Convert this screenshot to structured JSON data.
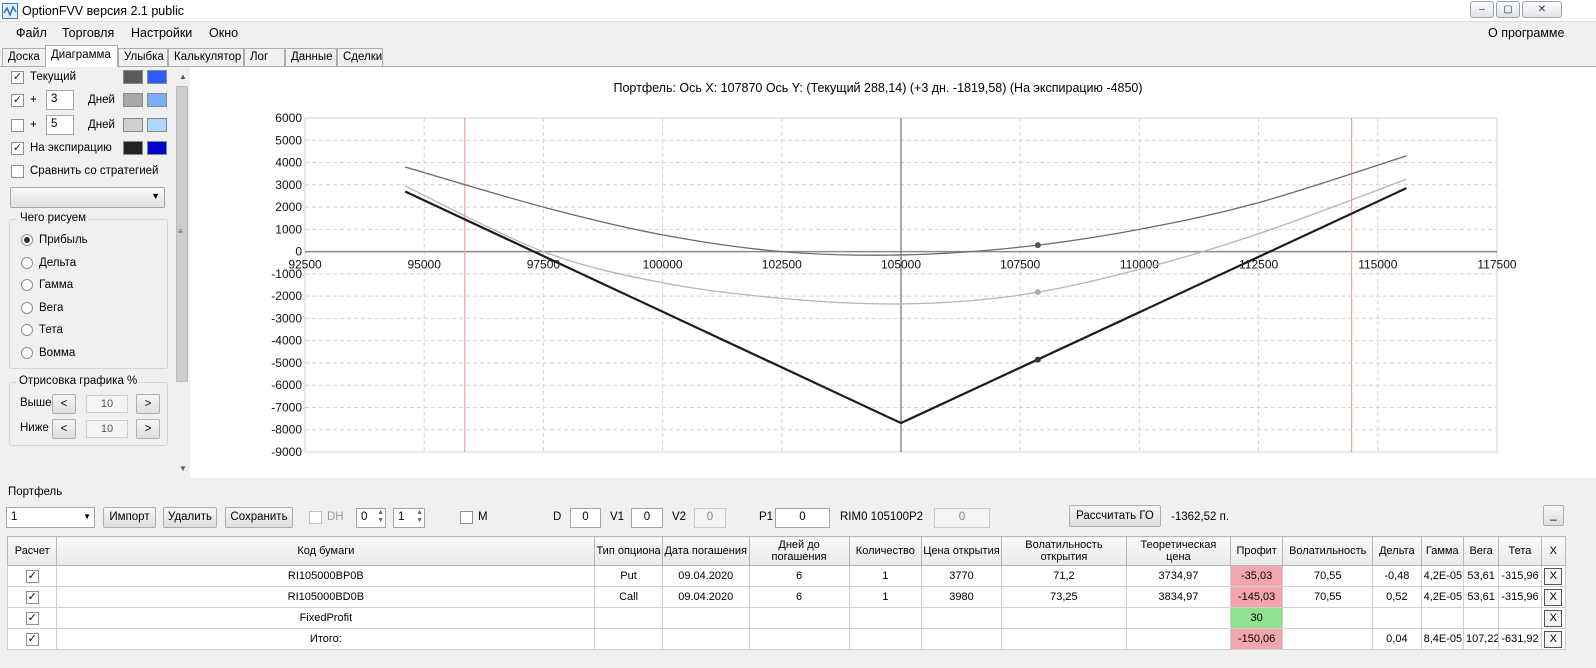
{
  "window": {
    "title": "OptionFVV версия 2.1 public",
    "min": "–",
    "restore": "▢",
    "close": "✕"
  },
  "menu": {
    "items": [
      "Файл",
      "Торговля",
      "Настройки",
      "Окно"
    ],
    "about": "О программе"
  },
  "tabs": [
    "Доска",
    "Диаграмма",
    "Улыбка",
    "Калькулятор",
    "Лог",
    "Данные",
    "Сделки"
  ],
  "left": {
    "current_label": "Текущий",
    "plus": "+",
    "days1": "3",
    "days2": "5",
    "days_label": "Дней",
    "expiry_label": "На экспирацию",
    "compare_label": "Сравнить со стратегией",
    "draw_group": "Чего рисуем",
    "radios": [
      "Прибыль",
      "Дельта",
      "Гамма",
      "Вега",
      "Тета",
      "Вомма"
    ],
    "percent_group": "Отрисовка графика %",
    "above_label": "Выше",
    "below_label": "Ниже",
    "above_value": "10",
    "below_value": "10",
    "left_arrow": "<",
    "right_arrow": ">",
    "colors": {
      "current": [
        "#5a5a5a",
        "#2a5cff"
      ],
      "days1": [
        "#a8a8a8",
        "#7aaeff"
      ],
      "days2": [
        "#cfcfcf",
        "#aed8ff"
      ],
      "expiry": [
        "#222222",
        "#0000cc"
      ]
    }
  },
  "chart_data": {
    "type": "line",
    "title": "Портфель: Ось X: 107870 Ось Y:  (Текущий 288,14)  (+3 дн. -1819,58)  (На экспирацию -4850)",
    "xlim": [
      92500,
      117500
    ],
    "ylim": [
      -9000,
      6000
    ],
    "xticks": [
      92500,
      95000,
      97500,
      100000,
      102500,
      105000,
      107500,
      110000,
      112500,
      115000,
      117500
    ],
    "yticks": [
      6000,
      5000,
      4000,
      3000,
      2000,
      1000,
      0,
      -1000,
      -2000,
      -3000,
      -4000,
      -5000,
      -6000,
      -7000,
      -8000,
      -9000
    ],
    "grid": true,
    "vertical_lines": [
      {
        "x": 105000,
        "color": "#707070"
      },
      {
        "x": 95850,
        "color": "#f2a3a3"
      },
      {
        "x": 114450,
        "color": "#f2a3a3"
      }
    ],
    "cursor_x": 107870,
    "series": [
      {
        "name": "Текущий",
        "color": "#6a6a6a",
        "width": 1.3,
        "x": [
          94600,
          97500,
          100000,
          102500,
          105000,
          107500,
          110000,
          112500,
          115600
        ],
        "y": [
          3800,
          2000,
          750,
          0,
          -150,
          200,
          1000,
          2200,
          4300
        ]
      },
      {
        "name": "+3 дн.",
        "color": "#b5b5b5",
        "width": 1.3,
        "x": [
          94600,
          97500,
          100000,
          102500,
          105000,
          107500,
          110000,
          112500,
          115600
        ],
        "y": [
          2950,
          0,
          -1400,
          -2100,
          -2350,
          -1950,
          -800,
          800,
          3250
        ]
      },
      {
        "name": "На экспирацию",
        "color": "#1c1c1c",
        "width": 2.2,
        "x": [
          94600,
          105000,
          115600
        ],
        "y": [
          2700,
          -7700,
          2850
        ]
      }
    ],
    "markers": [
      {
        "x": 107870,
        "y": 288.14,
        "color": "#555555"
      },
      {
        "x": 107870,
        "y": -1819.58,
        "color": "#b0b0b0"
      },
      {
        "x": 107870,
        "y": -4850,
        "color": "#333333"
      }
    ]
  },
  "portfolio": {
    "label": "Портфель",
    "selected": "1",
    "import": "Импорт",
    "delete": "Удалить",
    "save": "Сохранить",
    "dh": "DH",
    "dh1": "0",
    "dh2": "1",
    "m": "M",
    "d_label": "D",
    "d_value": "0",
    "v1_label": "V1",
    "v1_value": "0",
    "v2_label": "V2",
    "v2_value": "0",
    "p1_label": "P1",
    "p1_value": "0",
    "rim": "RIM0 105100",
    "p2_label": "P2",
    "p2_value": "0",
    "calc_go": "Рассчитать ГО",
    "go_value": "-1362,52 п.",
    "collapse": "_"
  },
  "table": {
    "headers": [
      "Расчет",
      "Код бумаги",
      "Тип опциона",
      "Дата погашения",
      "Дней до погашения",
      "Количество",
      "Цена открытия",
      "Волатильность открытия",
      "Теоретическая цена",
      "Профит",
      "Волатильность",
      "Дельта",
      "Гамма",
      "Вега",
      "Тета",
      "X"
    ],
    "rows": [
      {
        "check": "✓",
        "code": "RI105000BP0B",
        "type": "Put",
        "date": "09.04.2020",
        "days": "6",
        "qty": "1",
        "open": "3770",
        "ovol": "71,2",
        "theo": "3734,97",
        "profit": "-35,03",
        "vol": "70,55",
        "delta": "-0,48",
        "gamma": "4,2E-05",
        "vega": "53,61",
        "theta": "-315,96",
        "x": "X"
      },
      {
        "check": "✓",
        "code": "RI105000BD0B",
        "type": "Call",
        "date": "09.04.2020",
        "days": "6",
        "qty": "1",
        "open": "3980",
        "ovol": "73,25",
        "theo": "3834,97",
        "profit": "-145,03",
        "vol": "70,55",
        "delta": "0,52",
        "gamma": "4,2E-05",
        "vega": "53,61",
        "theta": "-315,96",
        "x": "X"
      },
      {
        "check": "✓",
        "code": "FixedProfit",
        "type": "",
        "date": "",
        "days": "",
        "qty": "",
        "open": "",
        "ovol": "",
        "theo": "",
        "profit": "30",
        "vol": "",
        "delta": "",
        "gamma": "",
        "vega": "",
        "theta": "",
        "x": "X"
      },
      {
        "check": "✓",
        "code": "Итого:",
        "type": "",
        "date": "",
        "days": "",
        "qty": "",
        "open": "",
        "ovol": "",
        "theo": "",
        "profit": "-150,06",
        "vol": "",
        "delta": "0,04",
        "gamma": "8,4E-05",
        "vega": "107,22",
        "theta": "-631,92",
        "x": "X"
      }
    ]
  }
}
